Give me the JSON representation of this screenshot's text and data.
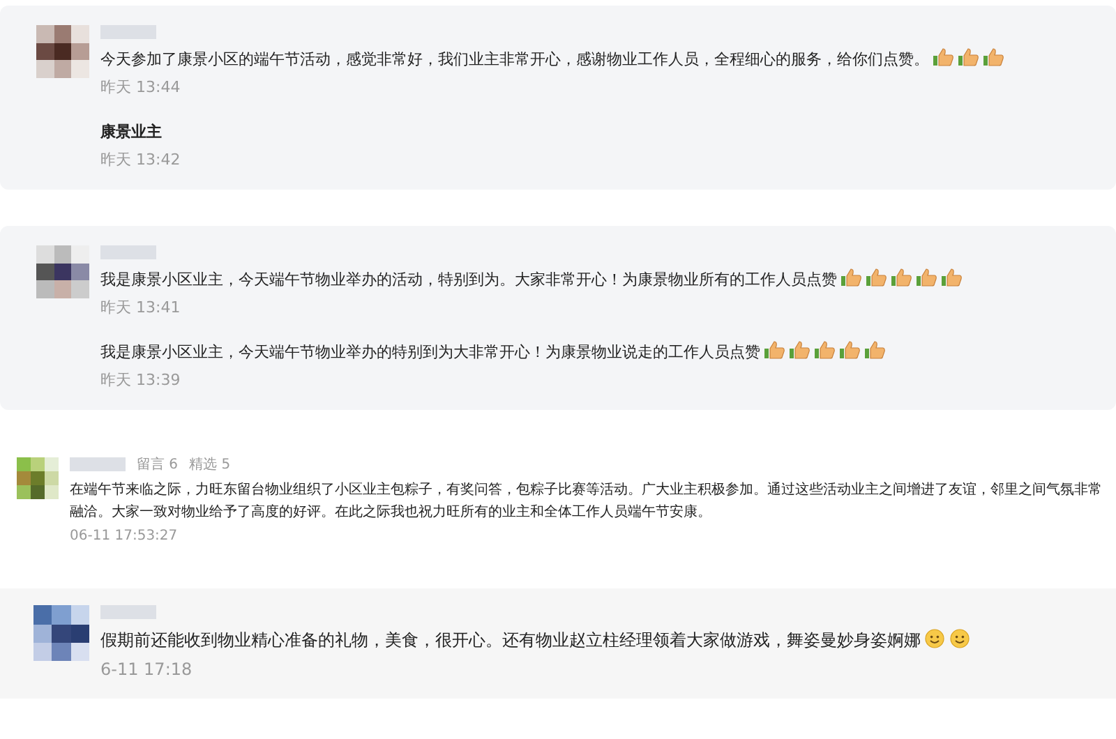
{
  "threads": [
    {
      "entries": [
        {
          "text": "今天参加了康景小区的端午节活动，感觉非常好，我们业主非常开心，感谢物业工作人员，全程细心的服务，给你们点赞。",
          "bold": false,
          "emojis": [
            {
              "kind": "thumbs"
            },
            {
              "kind": "thumbs"
            },
            {
              "kind": "thumbs"
            }
          ],
          "time": "昨天 13:44"
        },
        {
          "text": "康景业主",
          "bold": true,
          "time": "昨天 13:42"
        }
      ]
    },
    {
      "entries": [
        {
          "text": "我是康景小区业主，今天端午节物业举办的活动，特别到为。大家非常开心！为康景物业所有的工作人员点赞",
          "bold": false,
          "emojis": [
            {
              "kind": "thumbs"
            },
            {
              "kind": "thumbs"
            },
            {
              "kind": "thumbs"
            },
            {
              "kind": "thumbs"
            },
            {
              "kind": "thumbs"
            }
          ],
          "time": "昨天 13:41"
        },
        {
          "text": "我是康景小区业主，今天端午节物业举办的特别到为大非常开心！为康景物业说走的工作人员点赞",
          "bold": false,
          "emojis": [
            {
              "kind": "thumbs"
            },
            {
              "kind": "thumbs"
            },
            {
              "kind": "thumbs"
            },
            {
              "kind": "thumbs"
            },
            {
              "kind": "thumbs"
            }
          ],
          "time": "昨天 13:39"
        }
      ]
    },
    {
      "meta": [
        "留言 6",
        "精选 5"
      ],
      "entries": [
        {
          "text": "在端午节来临之际，力旺东留台物业组织了小区业主包粽子，有奖问答，包粽子比赛等活动。广大业主积极参加。通过这些活动业主之间增进了友谊，邻里之间气氛非常融洽。大家一致对物业给予了高度的好评。在此之际我也祝力旺所有的业主和全体工作人员端午节安康。",
          "bold": false,
          "time": "06-11 17:53:27"
        }
      ]
    },
    {
      "entries": [
        {
          "text": "假期前还能收到物业精心准备的礼物，美食，很开心。还有物业赵立柱经理领着大家做游戏，舞姿曼妙身姿婀娜",
          "bold": false,
          "emojis": [
            {
              "kind": "smile"
            },
            {
              "kind": "smile"
            }
          ],
          "time": "6-11 17:18"
        }
      ]
    }
  ]
}
